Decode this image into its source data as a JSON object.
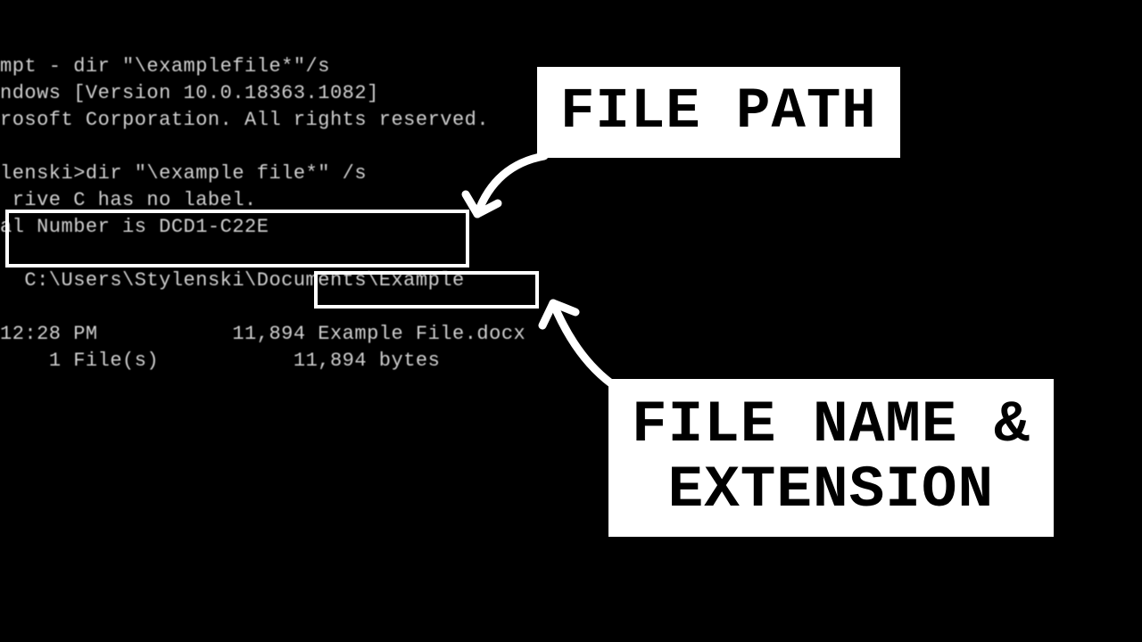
{
  "console": {
    "title_line": "mpt - dir \"\\examplefile*\"/s",
    "windows_line": "ndows [Version 10.0.18363.1082]",
    "copyright_line": "rosoft Corporation. All rights reserved.",
    "prompt_line": "lenski>dir \"\\example file*\" /s",
    "drive_line": " rive C has no label.",
    "serial_line": "al Number is DCD1-C22E",
    "dir_path": "C:\\Users\\Stylenski\\Documents\\Example",
    "time": "12:28 PM",
    "size": "11,894",
    "filename": "Example File.docx",
    "files_count": "1 File(s)",
    "bytes": "11,894 bytes"
  },
  "labels": {
    "path": "FILE PATH",
    "name_line1": "FILE NAME &",
    "name_line2": "EXTENSION"
  }
}
